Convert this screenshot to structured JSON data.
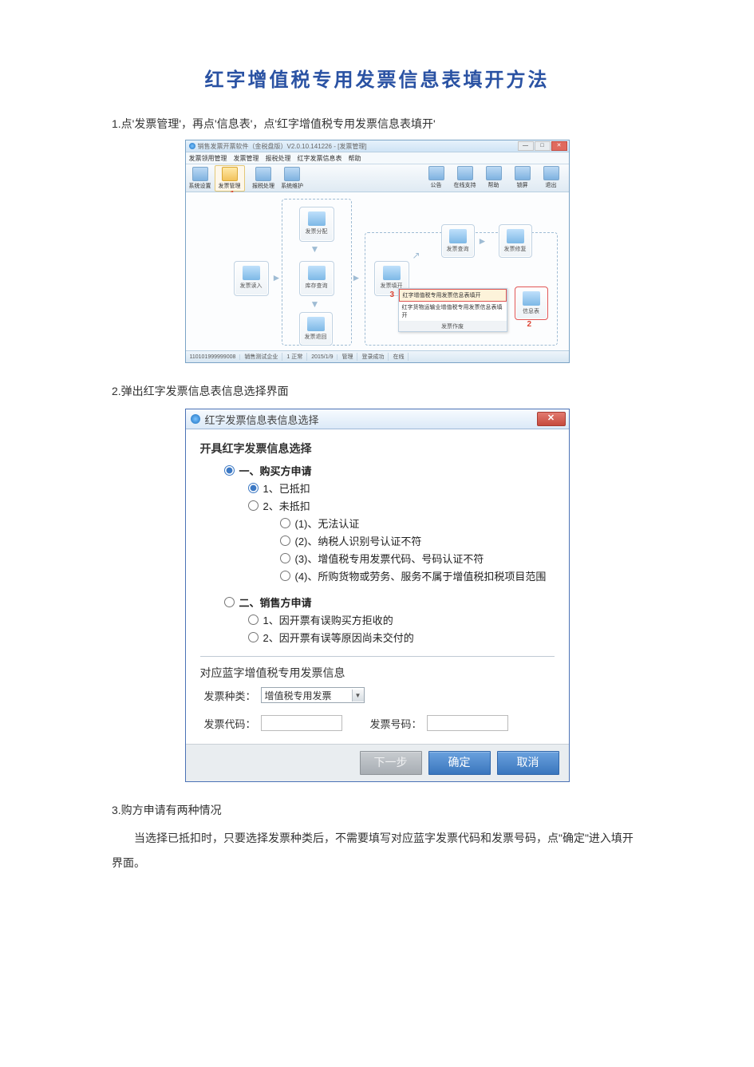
{
  "title": "红字增值税专用发票信息表填开方法",
  "step1": "1.点'发票管理'，再点'信息表'，点'红字增值税专用发票信息表填开'",
  "step2": "2.弹出红字发票信息表信息选择界面",
  "step3": "3.购方申请有两种情况",
  "step3_detail": "当选择已抵扣时，只要选择发票种类后，不需要填写对应蓝字发票代码和发票号码，点\"确定\"进入填开界面。",
  "app": {
    "title_dim": "销售发票开票软件（金税盘版）V2.0.10.141226 - [发票管理]",
    "win_min": "—",
    "win_max": "□",
    "win_close": "✕",
    "menus": [
      "发票领用管理",
      "发票管理",
      "报税处理",
      "红字发票信息表",
      "帮助"
    ],
    "tools_left": [
      {
        "label": "系统设置"
      },
      {
        "label": "发票管理"
      },
      {
        "label": "报税处理"
      },
      {
        "label": "系统维护"
      }
    ],
    "tools_right": [
      {
        "label": "公告"
      },
      {
        "label": "在线支持"
      },
      {
        "label": "帮助"
      },
      {
        "label": "锁屏"
      },
      {
        "label": "退出"
      }
    ],
    "marker1": "1",
    "marker2": "2",
    "marker3": "3",
    "boxes": {
      "fpfz": "发票分配",
      "fpds": "发票读入",
      "kcxx": "库存查询",
      "fptx": "发票填开",
      "fpcx": "发票查询",
      "fpxf": "发票修复",
      "xxb": "信息表",
      "fpzf": "发票作废",
      "fpth": "发票退回"
    },
    "popup": {
      "item1": "红字增值税专用发票信息表填开",
      "item2": "红字货物运输业增值税专用发票信息表填开",
      "footer": "发票作废"
    },
    "status": [
      "110101999999008",
      "销售测试企业",
      "1 正常",
      "2015/1/9",
      "管理",
      "登录成功",
      "在线"
    ]
  },
  "dlg": {
    "title": "红字发票信息表信息选择",
    "close": "✕",
    "group1": "开具红字发票信息选择",
    "opt_buyer": "一、购买方申请",
    "opt_1_1": "1、已抵扣",
    "opt_1_2": "2、未抵扣",
    "opt_1_2_1": "(1)、无法认证",
    "opt_1_2_2": "(2)、纳税人识别号认证不符",
    "opt_1_2_3": "(3)、增值税专用发票代码、号码认证不符",
    "opt_1_2_4": "(4)、所购货物或劳务、服务不属于增值税扣税项目范围",
    "opt_seller": "二、销售方申请",
    "opt_2_1": "1、因开票有误购买方拒收的",
    "opt_2_2": "2、因开票有误等原因尚未交付的",
    "blue_group": "对应蓝字增值税专用发票信息",
    "ftype_label": "发票种类：",
    "ftype_value": "增值税专用发票",
    "fcode_label": "发票代码：",
    "fnum_label": "发票号码：",
    "btn_next": "下一步",
    "btn_ok": "确定",
    "btn_cancel": "取消"
  }
}
